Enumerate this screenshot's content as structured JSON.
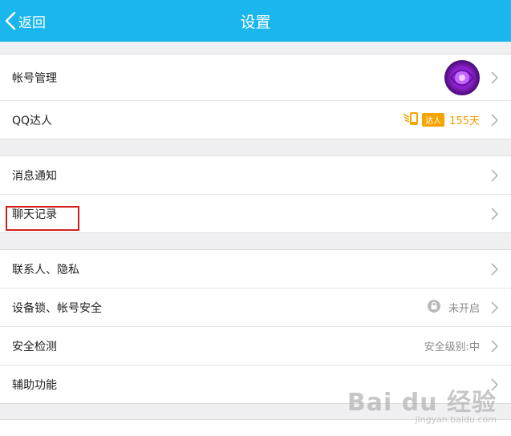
{
  "header": {
    "back_label": "返回",
    "title": "设置",
    "bg_color": "#1cb6ee"
  },
  "groups": [
    {
      "rows": [
        {
          "label": "帐号管理"
        },
        {
          "label": "QQ达人",
          "badge_text": "达人",
          "days": "155天"
        }
      ]
    },
    {
      "rows": [
        {
          "label": "消息通知"
        },
        {
          "label": "聊天记录"
        }
      ]
    },
    {
      "rows": [
        {
          "label": "联系人、隐私"
        },
        {
          "label": "设备锁、帐号安全",
          "value": "未开启",
          "icon": "lock-icon"
        },
        {
          "label": "安全检测",
          "value": "安全级别:中"
        },
        {
          "label": "辅助功能"
        }
      ]
    }
  ],
  "watermark": {
    "logo": "Bai du 经验",
    "url": "jingyan.baidu.com"
  },
  "colors": {
    "accent": "#1cb6ee",
    "talent_orange": "#f59a00",
    "highlight_red": "#d11f1f"
  }
}
